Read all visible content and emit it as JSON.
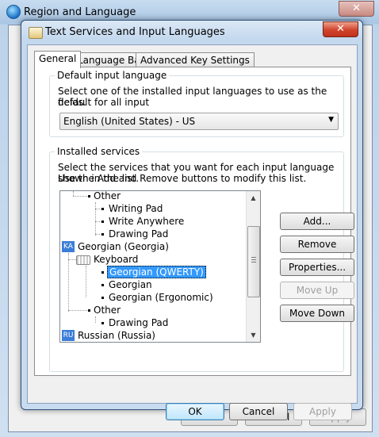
{
  "parent_window": {
    "title": "Region and Language",
    "close_glyph": "✕",
    "buttons": {
      "ok": "OK",
      "cancel": "Cancel",
      "apply": "Apply"
    }
  },
  "dialog": {
    "title": "Text Services and Input Languages",
    "close_glyph": "✕",
    "tabs": [
      {
        "label": "General",
        "active": true
      },
      {
        "label": "Language Bar",
        "active": false
      },
      {
        "label": "Advanced Key Settings",
        "active": false
      }
    ],
    "default_input": {
      "group_label": "Default input language",
      "description_line1": "Select one of the installed input languages to use as the default for all input",
      "description_line2": "fields.",
      "selected_value": "English (United States) - US"
    },
    "installed_services": {
      "group_label": "Installed services",
      "description_line1": "Select the services that you want for each input language shown in the list.",
      "description_line2": "Use the Add and Remove buttons to modify this list.",
      "tree": {
        "other_1": "Other",
        "writing_pad": "Writing Pad",
        "write_anywhere": "Write Anywhere",
        "drawing_pad_1": "Drawing Pad",
        "georgian_badge": "KA",
        "georgian_lang": "Georgian (Georgia)",
        "keyboard": "Keyboard",
        "georgian_qwerty": "Georgian (QWERTY)",
        "georgian": "Georgian",
        "georgian_ergonomic": "Georgian (Ergonomic)",
        "other_2": "Other",
        "drawing_pad_2": "Drawing Pad",
        "russian_badge": "RU",
        "russian_lang": "Russian (Russia)"
      },
      "buttons": {
        "add": "Add...",
        "remove": "Remove",
        "properties": "Properties...",
        "move_up": "Move Up",
        "move_down": "Move Down"
      }
    },
    "buttons": {
      "ok": "OK",
      "cancel": "Cancel",
      "apply": "Apply"
    }
  },
  "colors": {
    "selection": "#3399ff",
    "language_badge": "#3b7dd8",
    "close_button": "#d0432c"
  }
}
